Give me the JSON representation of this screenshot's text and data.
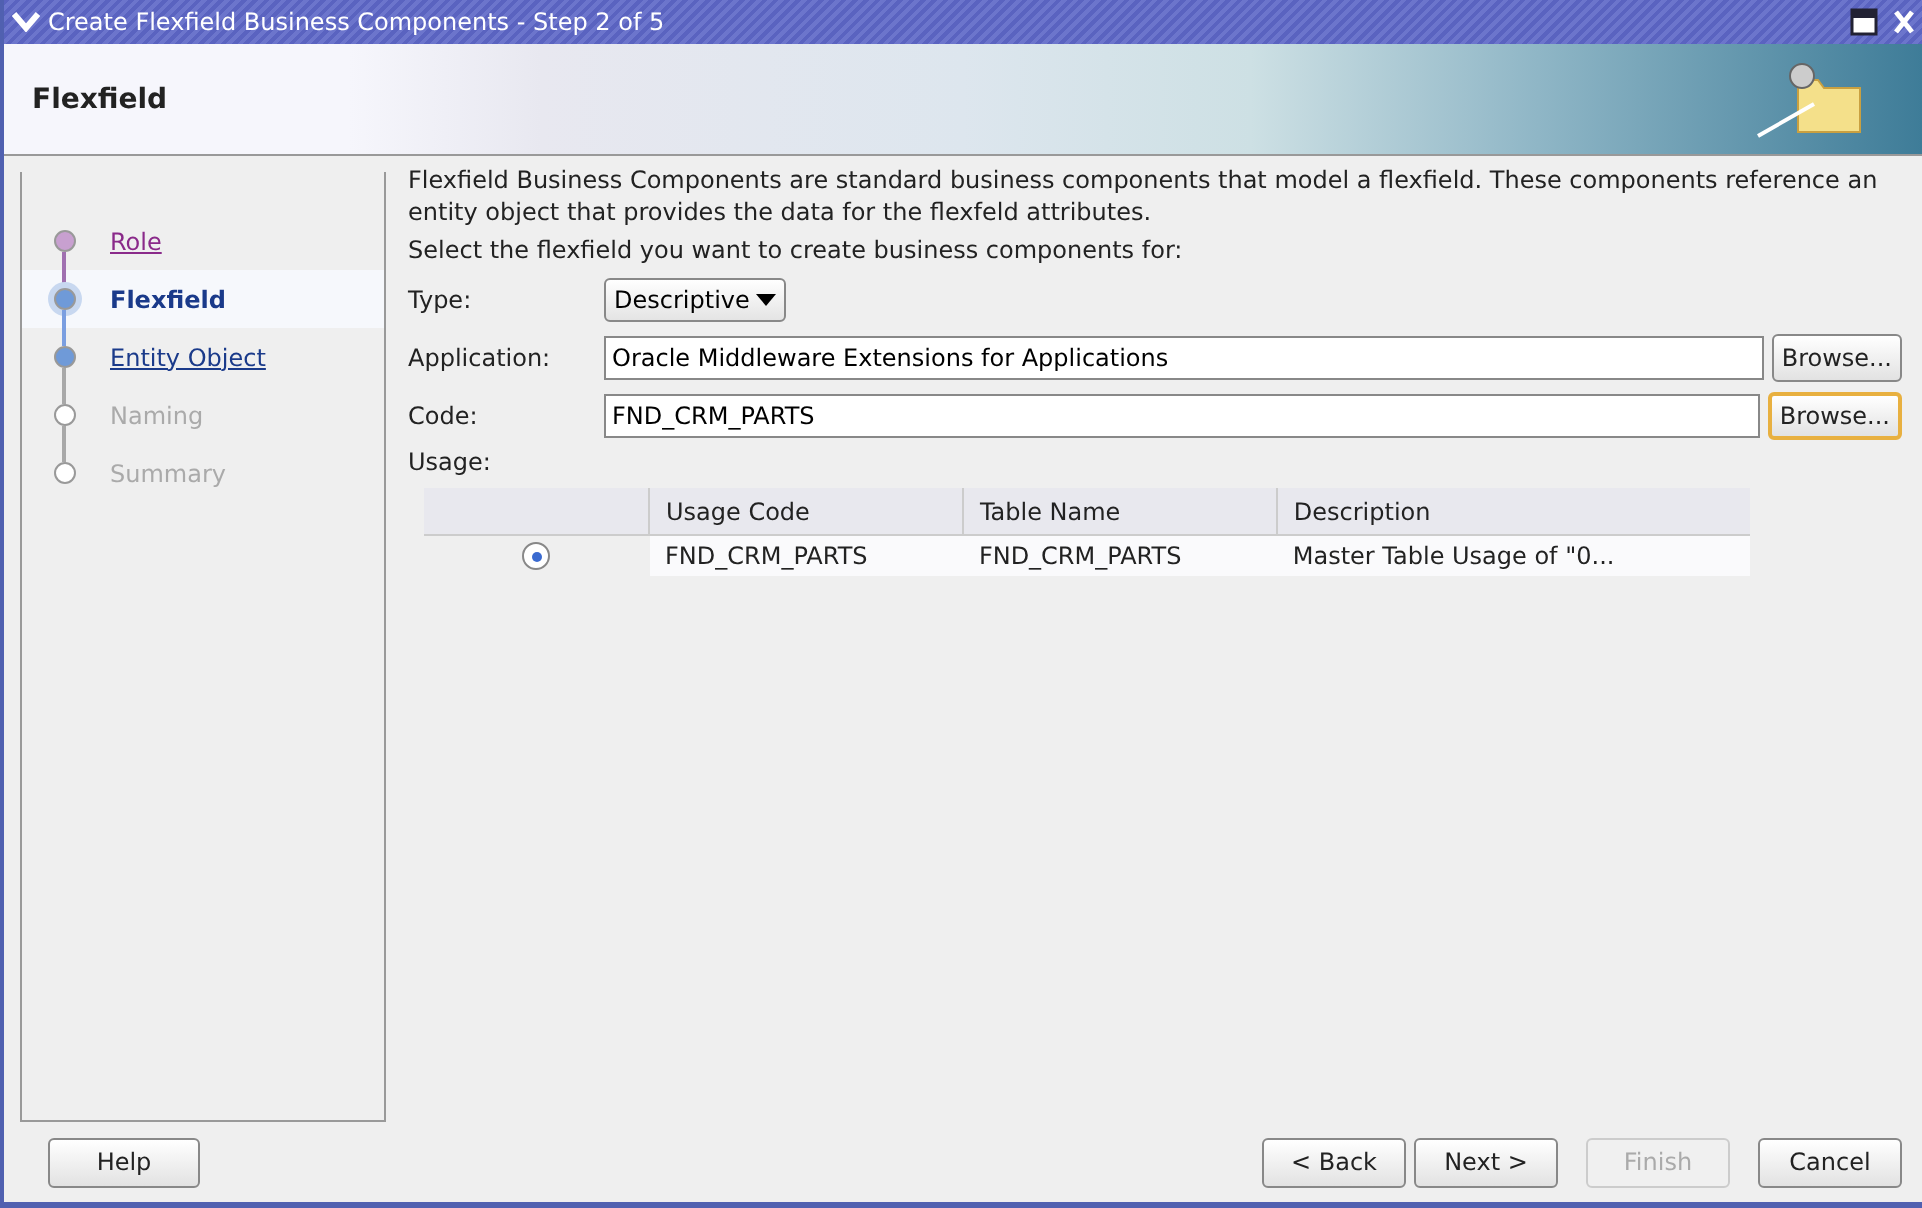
{
  "window": {
    "title": "Create Flexfield Business Components - Step 2 of 5"
  },
  "header": {
    "title": "Flexfield"
  },
  "steps": [
    {
      "label": "Role",
      "kind": "visited"
    },
    {
      "label": "Flexfield",
      "kind": "current"
    },
    {
      "label": "Entity Object",
      "kind": "link"
    },
    {
      "label": "Naming",
      "kind": "disabled"
    },
    {
      "label": "Summary",
      "kind": "disabled"
    }
  ],
  "intro": "Flexfield Business Components are standard business components that model a flexfield. These components reference an entity object that provides the data for the flexfeld attributes.",
  "prompt": "Select the flexfield you want to create business components for:",
  "type": {
    "label": "Type:",
    "value": "Descriptive"
  },
  "application": {
    "label": "Application:",
    "value": "Oracle Middleware Extensions for Applications",
    "button": "Browse...",
    "focused": false
  },
  "code": {
    "label": "Code:",
    "value": "FND_CRM_PARTS",
    "button": "Browse...",
    "focused": true
  },
  "usage": {
    "label": "Usage:",
    "columns": [
      "Usage Code",
      "Table Name",
      "Description"
    ],
    "rows": [
      {
        "selected": true,
        "cells": [
          "FND_CRM_PARTS",
          "FND_CRM_PARTS",
          "Master Table Usage of \"0..."
        ]
      }
    ]
  },
  "buttons": {
    "help": "Help",
    "back": "< Back",
    "next": "Next >",
    "finish": {
      "label": "Finish",
      "disabled": true
    },
    "cancel": "Cancel"
  }
}
